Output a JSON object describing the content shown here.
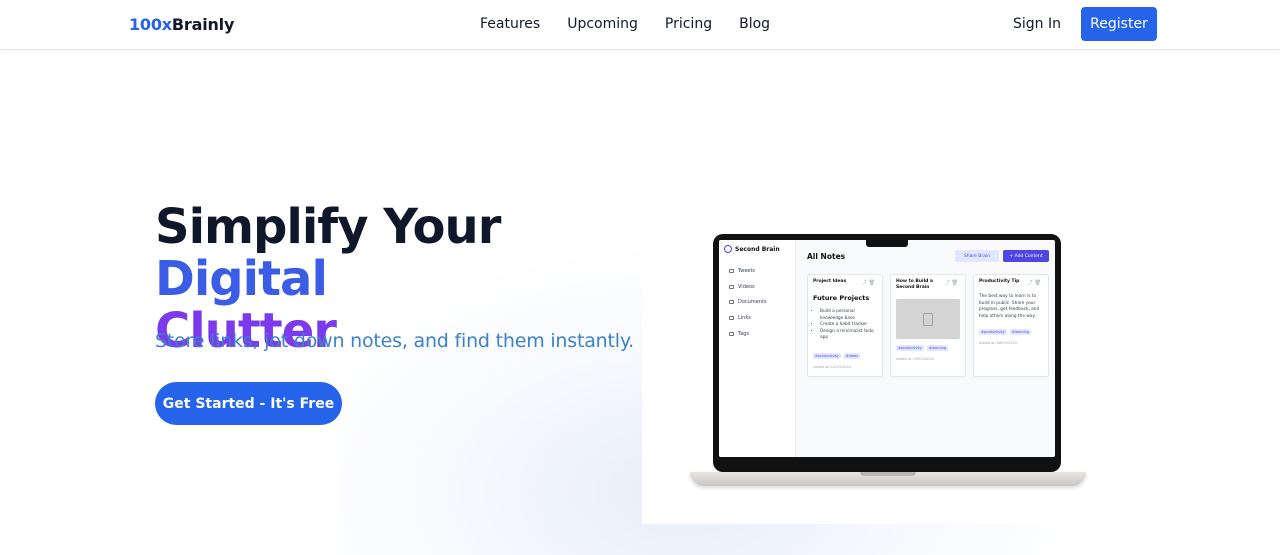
{
  "nav": {
    "logo_prefix": "100x",
    "logo_suffix": "Brainly",
    "links": [
      "Features",
      "Upcoming",
      "Pricing",
      "Blog"
    ],
    "signin": "Sign In",
    "register": "Register"
  },
  "hero": {
    "title_part1": "Simplify Your ",
    "title_part2": "Digital",
    "title_part3": "Clutter",
    "subtitle": "Store links, jot down notes, and find them instantly.",
    "cta": "Get Started - It's Free"
  },
  "colors": {
    "accent": "#2563eb",
    "purple": "#7c3aed",
    "subtitle": "#3b82c8"
  },
  "mockup": {
    "brand": "Second Brain",
    "sidebar": [
      "Tweets",
      "Videos",
      "Documents",
      "Links",
      "Tags"
    ],
    "main_title": "All Notes",
    "share_label": "Share Brain",
    "add_label": "+ Add Content",
    "cards": [
      {
        "title": "Project Ideas",
        "heading": "Future Projects",
        "bullets": [
          "Build a personal knowledge base",
          "Create a habit tracker",
          "Design a minimalist todo app"
        ],
        "tags": [
          "#productivity",
          "#ideas"
        ],
        "date": "Added on 10/03/2024"
      },
      {
        "title": "How to Build a Second Brain",
        "tags": [
          "#productivity",
          "#learning"
        ],
        "date": "Added on 09/03/2024"
      },
      {
        "title": "Productivity Tip",
        "text": "The best way to learn is to build in public. Share your progress, get feedback, and help others along the way.",
        "tags": [
          "#productivity",
          "#learning"
        ],
        "date": "Added on 08/03/2024"
      }
    ]
  }
}
